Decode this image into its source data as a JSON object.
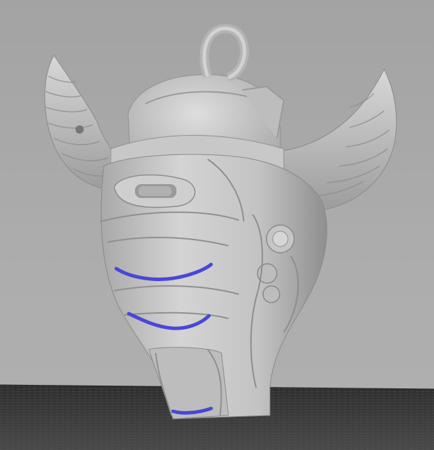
{
  "viewport": {
    "background_color": "#a9a9a9",
    "build_plate_color": "#3a3a3a",
    "model_color": "#c4c4c4",
    "support_highlight_color": "#4a4ad8"
  },
  "model": {
    "icon": "horned-helmet-mask-3d-model"
  }
}
